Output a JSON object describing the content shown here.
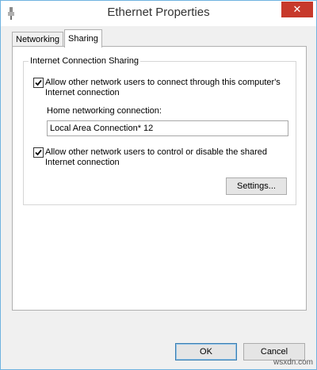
{
  "window": {
    "title": "Ethernet Properties",
    "close_label": "✕"
  },
  "tabs": [
    {
      "label": "Networking"
    },
    {
      "label": "Sharing"
    }
  ],
  "sharing": {
    "group_title": "Internet Connection Sharing",
    "allow_connect": {
      "checked": true,
      "label_line1": "Allow other network users to connect through this computer's",
      "label_line2": "Internet connection"
    },
    "home_label": "Home networking connection:",
    "home_value": "Local Area Connection* 12",
    "allow_control": {
      "checked": true,
      "label_line1": "Allow other network users to control or disable the shared",
      "label_line2": "Internet connection"
    },
    "settings_label": "Settings..."
  },
  "footer": {
    "ok_label": "OK",
    "cancel_label": "Cancel"
  },
  "watermark": "wsxdn.com",
  "colors": {
    "border": "#6fb3e0",
    "close_button": "#c7392b"
  }
}
